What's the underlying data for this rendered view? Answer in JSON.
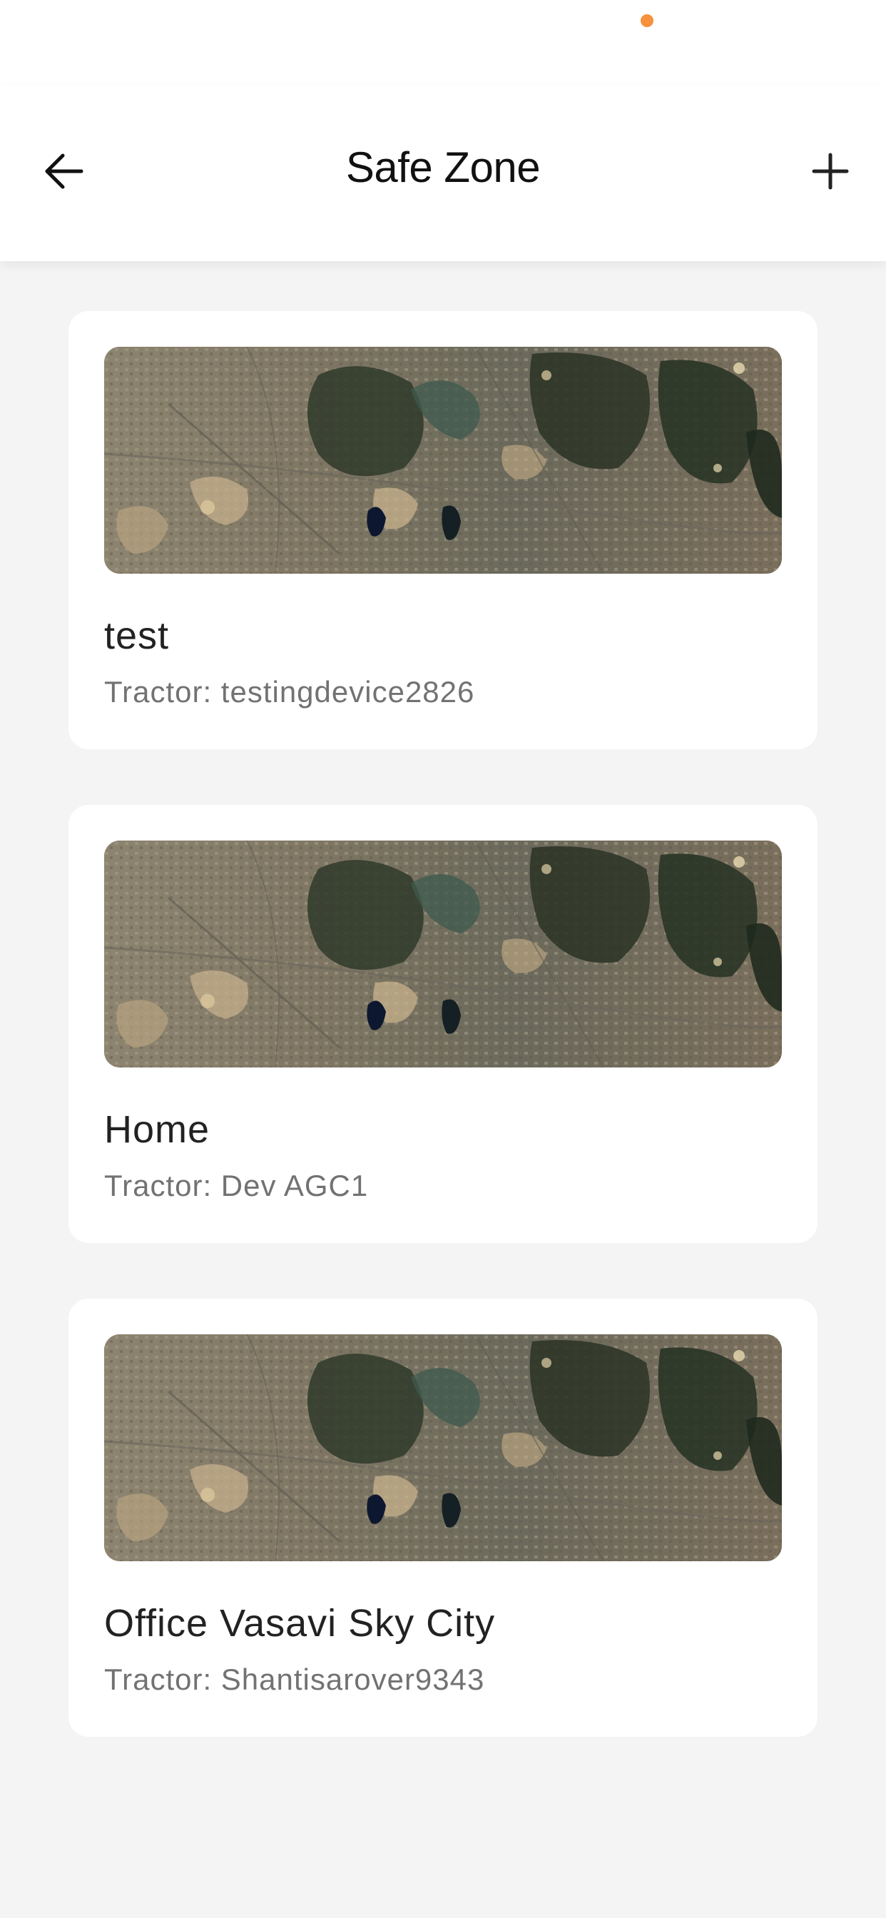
{
  "header": {
    "title": "Safe Zone",
    "back_icon": "arrow-left-icon",
    "add_icon": "plus-icon"
  },
  "colors": {
    "status_dot": "#f7913b",
    "text_primary": "#222222",
    "text_secondary": "#727272",
    "background": "#f4f4f4"
  },
  "zones": [
    {
      "name": "test",
      "tractor": "Tractor: testingdevice2826",
      "thumbnail": "satellite-map-thumbnail"
    },
    {
      "name": "Home",
      "tractor": "Tractor: Dev AGC1",
      "thumbnail": "satellite-map-thumbnail"
    },
    {
      "name": "Office Vasavi Sky City",
      "tractor": "Tractor: Shantisarover9343",
      "thumbnail": "satellite-map-thumbnail"
    }
  ]
}
